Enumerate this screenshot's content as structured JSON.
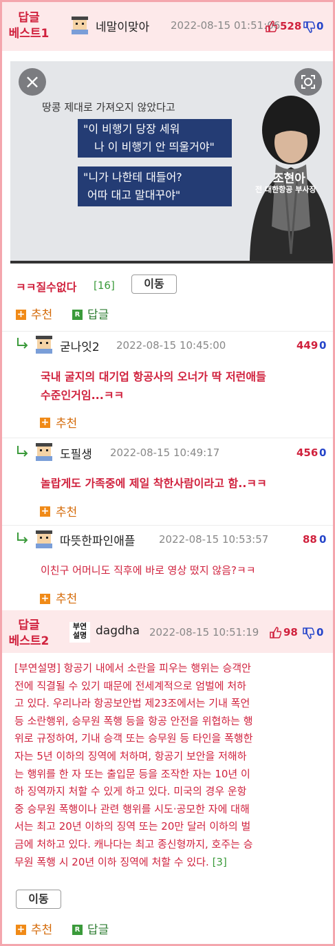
{
  "best1": {
    "label_line1": "답글",
    "label_line2": "베스트1",
    "username": "네말이맞아",
    "date": "2022-08-15 01:51:06",
    "up": "528",
    "down": "0"
  },
  "image": {
    "caption": "땅콩 제대로 가져오지 않았다고",
    "quote1_line1": "\"이 비행기 당장 세워",
    "quote1_line2": "나 이 비행기 안 띄울거야\"",
    "quote2_line1": "\"니가 나한테 대들어?",
    "quote2_line2": "어따 대고 말대꾸야\"",
    "name": "조현아",
    "title": "전 대한항공 부사장"
  },
  "post1": {
    "title": "ㅋㅋ질수없다",
    "reply_count": "[16]",
    "move_label": "이동",
    "recommend_label": "추천",
    "reply_label": "답글"
  },
  "replies": [
    {
      "username": "굳나잇2",
      "date": "2022-08-15 10:45:00",
      "up": "449",
      "down": "0",
      "text_line1": "국내 굴지의 대기업 항공사의 오너가 딱 저런애들",
      "text_line2": "수준인거임...ㅋㅋ",
      "recommend_label": "추천"
    },
    {
      "username": "도필생",
      "date": "2022-08-15 10:49:17",
      "up": "456",
      "down": "0",
      "text_line1": "놀랍게도 가족중에 제일 착한사람이라고 함..ㅋㅋ",
      "recommend_label": "추천"
    },
    {
      "username": "따뜻한파인애플",
      "date": "2022-08-15 10:53:57",
      "up": "88",
      "down": "0",
      "text_line1": "이친구 어머니도 직후에 바로 영상 떴지 않음?ㅋㅋ",
      "recommend_label": "추천"
    }
  ],
  "best2": {
    "label_line1": "답글",
    "label_line2": "베스트2",
    "avatar_text1": "부연",
    "avatar_text2": "설명",
    "username": "dagdha",
    "date": "2022-08-15 10:51:19",
    "up": "98",
    "down": "0",
    "body_lines": [
      "[부연설명] 항공기 내에서 소란을 피우는 행위는 승객안",
      "전에 직결될 수 있기 때문에 전세계적으로 엄벌에 처하",
      "고 있다. 우리나라 항공보안법 제23조에서는 기내 폭언",
      "등 소란행위, 승무원 폭행 등을 항공 안전을 위협하는 행",
      "위로 규정하여, 기내 승객 또는 승무원 등 타인을 폭행한",
      "자는 5년 이하의 징역에 처하며, 항공기 보안을 저해하",
      "는 행위를 한 자 또는 출입문 등을 조작한 자는 10년 이",
      "하 징역까지 처할 수 있게 하고 있다. 미국의 경우 운항",
      "중 승무원 폭행이나 관련 행위를 시도·공모한 자에 대해",
      "서는 최고 20년 이하의 징역 또는 20만 달러 이하의 벌",
      "금에 처하고 있다. 캐나다는 최고 종신형까지, 호주는 승",
      "무원 폭행 시 20년 이하 징역에 처할 수 있다."
    ],
    "reply_count": "[3]",
    "move_label": "이동",
    "recommend_label": "추천",
    "reply_label": "답글"
  },
  "colors": {
    "accent_red": "#d0213d",
    "vote_blue": "#2444c9",
    "best_bg": "#fde9ea",
    "frame_border": "#f4a6ad"
  }
}
